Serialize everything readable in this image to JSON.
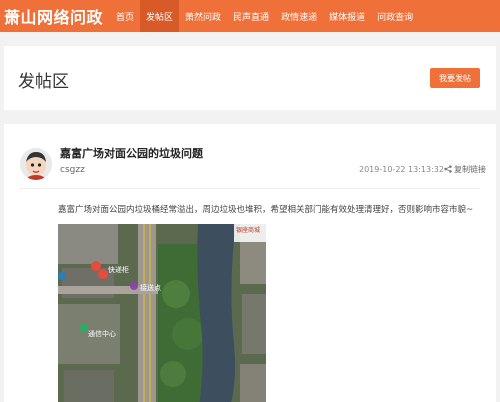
{
  "header": {
    "logo": "萧山网络问政",
    "nav": [
      "首页",
      "发帖区",
      "萧然问政",
      "民声直通",
      "政情速递",
      "媒体报道",
      "问政查询"
    ],
    "active_index": 1,
    "accent": "#f0703a"
  },
  "section": {
    "title": "发帖区",
    "post_button": "我要发帖"
  },
  "post": {
    "title": "嘉富广场对面公园的垃圾问题",
    "author": "csgzz",
    "time": "2019-10-22 13:13:32",
    "copy_link": "复制链接",
    "body": "嘉富广场对面公园内垃圾桶经常溢出，周边垃圾也堆积，希望相关部门能有效处理清理好，否则影响市容市貌~",
    "avatar_icon": "user-avatar-icon",
    "image": {
      "type": "satellite map",
      "labels": [
        "银座商城",
        "快递柜",
        "接送点",
        "通信中心"
      ]
    }
  }
}
